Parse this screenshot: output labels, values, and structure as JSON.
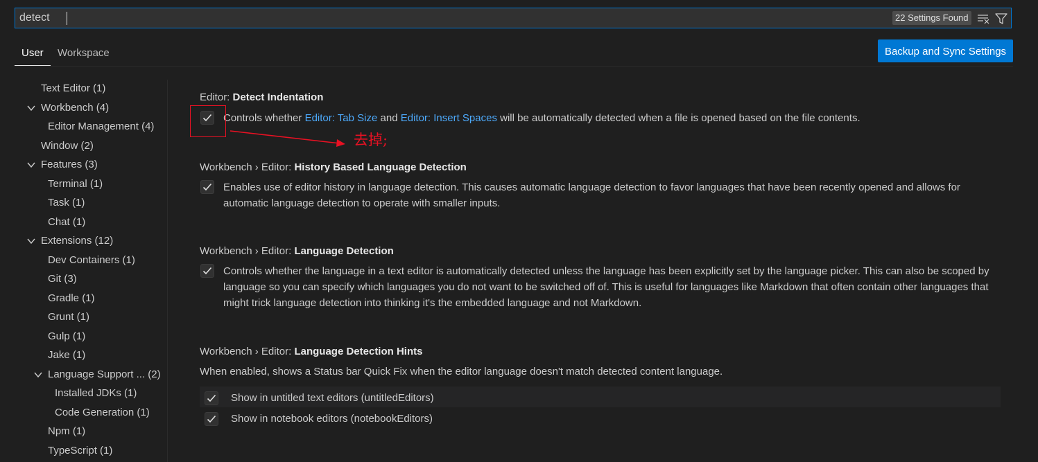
{
  "search": {
    "value": "detect",
    "results_badge": "22 Settings Found"
  },
  "tabs": [
    {
      "label": "User"
    },
    {
      "label": "Workspace"
    }
  ],
  "sync_button": "Backup and Sync Settings",
  "toc": {
    "items": [
      {
        "label": "Text Editor (1)"
      },
      {
        "label": "Workbench (4)"
      },
      {
        "label": "Editor Management (4)"
      },
      {
        "label": "Window (2)"
      },
      {
        "label": "Features (3)"
      },
      {
        "label": "Terminal (1)"
      },
      {
        "label": "Task (1)"
      },
      {
        "label": "Chat (1)"
      },
      {
        "label": "Extensions (12)"
      },
      {
        "label": "Dev Containers (1)"
      },
      {
        "label": "Git (3)"
      },
      {
        "label": "Gradle (1)"
      },
      {
        "label": "Grunt (1)"
      },
      {
        "label": "Gulp (1)"
      },
      {
        "label": "Jake (1)"
      },
      {
        "label": "Language Support ... (2)"
      },
      {
        "label": "Installed JDKs (1)"
      },
      {
        "label": "Code Generation (1)"
      },
      {
        "label": "Npm (1)"
      },
      {
        "label": "TypeScript (1)"
      }
    ]
  },
  "settings": [
    {
      "category": "Editor: ",
      "name": "Detect Indentation",
      "checked": true,
      "desc_prefix": "Controls whether ",
      "link1": "Editor: Tab Size",
      "desc_and": " and ",
      "link2": "Editor: Insert Spaces",
      "desc_suffix": " will be automatically detected when a file is opened based on the file contents."
    },
    {
      "category": "Workbench › Editor: ",
      "name": "History Based Language Detection",
      "checked": true,
      "description": "Enables use of editor history in language detection. This causes automatic language detection to favor languages that have been recently opened and allows for automatic language detection to operate with smaller inputs."
    },
    {
      "category": "Workbench › Editor: ",
      "name": "Language Detection",
      "checked": true,
      "description": "Controls whether the language in a text editor is automatically detected unless the language has been explicitly set by the language picker. This can also be scoped by language so you can specify which languages you do not want to be switched off of. This is useful for languages like Markdown that often contain other languages that might trick language detection into thinking it's the embedded language and not Markdown."
    },
    {
      "category": "Workbench › Editor: ",
      "name": "Language Detection Hints",
      "description": "When enabled, shows a Status bar Quick Fix when the editor language doesn't match detected content language.",
      "options": [
        {
          "label": "Show in untitled text editors (untitledEditors)",
          "checked": true
        },
        {
          "label": "Show in notebook editors (notebookEditors)",
          "checked": true
        }
      ]
    }
  ],
  "annotation": {
    "text": "去掉;",
    "color": "#e81123"
  },
  "colors": {
    "accent": "#0078d4",
    "link": "#4daafc",
    "background": "#1f1f1f"
  }
}
